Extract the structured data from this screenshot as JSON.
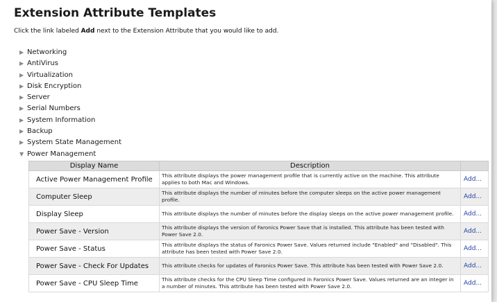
{
  "page": {
    "title": "Extension Attribute Templates",
    "instruction_before": "Click the link labeled ",
    "instruction_bold": "Add",
    "instruction_after": " next to the Extension Attribute that you would like to add."
  },
  "categories": [
    {
      "label": "Networking",
      "expanded": false
    },
    {
      "label": "AntiVirus",
      "expanded": false
    },
    {
      "label": "Virtualization",
      "expanded": false
    },
    {
      "label": "Disk Encryption",
      "expanded": false
    },
    {
      "label": "Server",
      "expanded": false
    },
    {
      "label": "Serial Numbers",
      "expanded": false
    },
    {
      "label": "System Information",
      "expanded": false
    },
    {
      "label": "Backup",
      "expanded": false
    },
    {
      "label": "System State Management",
      "expanded": false
    },
    {
      "label": "Power Management",
      "expanded": true
    }
  ],
  "icons": {
    "collapsed": "triangle-right-icon",
    "expanded": "triangle-down-icon"
  },
  "table": {
    "headers": {
      "name": "Display Name",
      "description": "Description",
      "action": ""
    },
    "add_label": "Add...",
    "rows": [
      {
        "name": "Active Power Management Profile",
        "description": "This attribute displays the power management profile that is currently active on the machine. This attribute applies to both Mac and Windows."
      },
      {
        "name": "Computer Sleep",
        "description": "This attribute displays the number of minutes before the computer sleeps on the active power management profile."
      },
      {
        "name": "Display Sleep",
        "description": "This attribute displays the number of minutes before the display sleeps on the active power management profile."
      },
      {
        "name": "Power Save - Version",
        "description": "This attribute displays the version of Faronics Power Save that is installed. This attribute has been tested with Power Save 2.0."
      },
      {
        "name": "Power Save - Status",
        "description": "This attribute displays the status of Faronics Power Save. Values returned include \"Enabled\" and \"Disabled\". This attribute has been tested with Power Save 2.0."
      },
      {
        "name": "Power Save - Check For Updates",
        "description": "This attribute checks for updates of Faronics Power Save. This attribute has been tested with Power Save 2.0."
      },
      {
        "name": "Power Save - CPU Sleep Time",
        "description": "This attribute checks for the CPU Sleep Time configured in Faronics Power Save. Values returned are an integer in a number of minutes. This attribute has been tested with Power Save 2.0."
      }
    ]
  },
  "colors": {
    "link": "#2743a8",
    "header_bg": "#dcdcdc",
    "alt_row_bg": "#ededed"
  }
}
